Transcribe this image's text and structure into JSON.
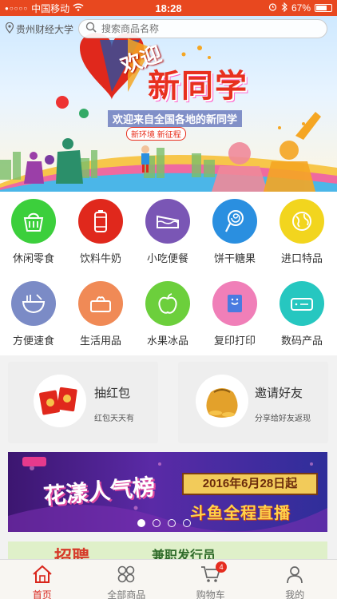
{
  "status_bar": {
    "carrier": "中国移动",
    "time": "18:28",
    "battery": "67%"
  },
  "header": {
    "location": "贵州财经大学",
    "search_placeholder": "搜索商品名称"
  },
  "banner": {
    "welcome": "欢迎",
    "title": "新同学",
    "subtitle": "欢迎来自全国各地的新同学",
    "tag": "新环境 新征程"
  },
  "categories": [
    {
      "label": "休闲零食",
      "color": "#3ccf3c",
      "icon": "basket-icon"
    },
    {
      "label": "饮料牛奶",
      "color": "#e0281c",
      "icon": "drink-can-icon"
    },
    {
      "label": "小吃便餐",
      "color": "#7a56b5",
      "icon": "cake-slice-icon"
    },
    {
      "label": "饼干糖果",
      "color": "#2a8fe0",
      "icon": "lollipop-icon"
    },
    {
      "label": "进口特品",
      "color": "#f2d51e",
      "icon": "globe-icon"
    },
    {
      "label": "方便速食",
      "color": "#7b8bc6",
      "icon": "noodle-bowl-icon"
    },
    {
      "label": "生活用品",
      "color": "#f08a56",
      "icon": "tissue-box-icon"
    },
    {
      "label": "水果冰品",
      "color": "#6ccf3c",
      "icon": "apple-icon"
    },
    {
      "label": "复印打印",
      "color": "#f07fb8",
      "icon": "printer-icon"
    },
    {
      "label": "数码产品",
      "color": "#26c7c0",
      "icon": "router-icon"
    }
  ],
  "promos": [
    {
      "title": "抽红包",
      "subtitle": "红包天天有"
    },
    {
      "title": "邀请好友",
      "subtitle": "分享给好友返现"
    }
  ],
  "ads": {
    "ad1_show": "花漾人气榜",
    "ad1_date": "2016年6月28日起",
    "ad1_live": "斗鱼全程直播",
    "ad2_big": "招聘",
    "ad2_text": "兼职发行员",
    "carousel_active_index": 0,
    "carousel_count": 4
  },
  "tabbar": {
    "items": [
      {
        "label": "首页"
      },
      {
        "label": "全部商品"
      },
      {
        "label": "购物车",
        "badge": "4"
      },
      {
        "label": "我的"
      }
    ],
    "active_index": 0
  }
}
